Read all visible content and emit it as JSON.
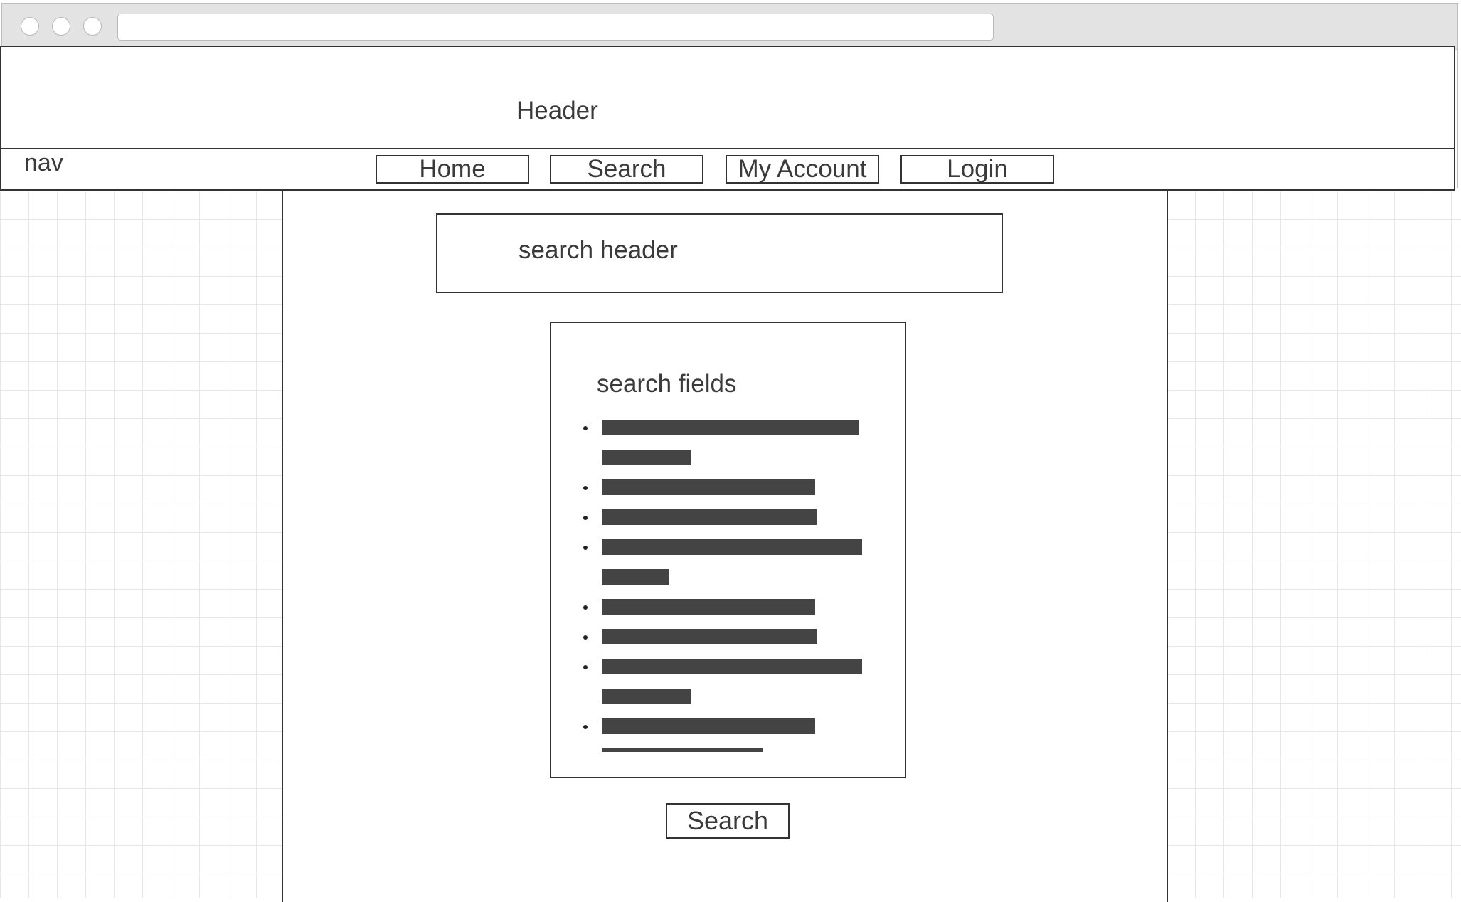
{
  "header": {
    "label": "Header"
  },
  "nav": {
    "label": "nav",
    "buttons": [
      "Home",
      "Search",
      "My Account",
      "Login"
    ]
  },
  "search_header": {
    "label": "search header"
  },
  "search_fields": {
    "title": "search fields",
    "items": 8
  },
  "search_button": {
    "label": "Search"
  }
}
